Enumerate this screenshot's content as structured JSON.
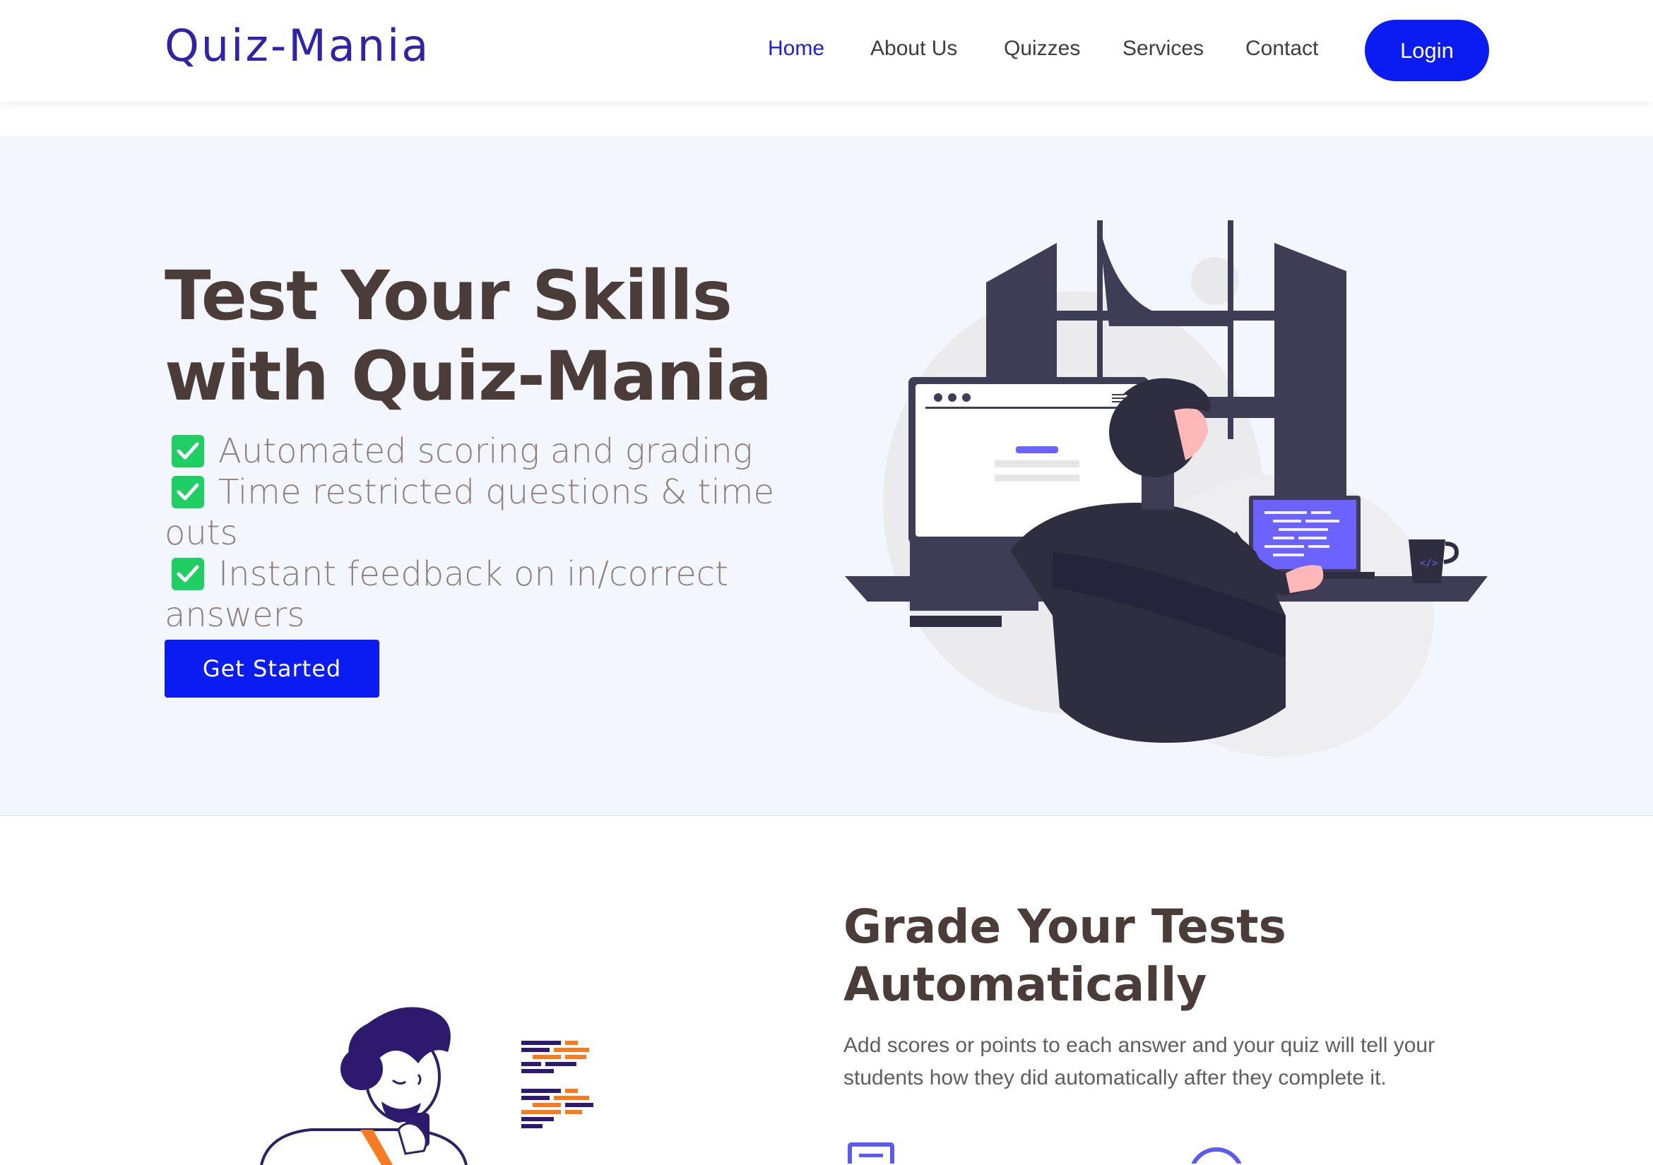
{
  "header": {
    "logo": "Quiz-Mania",
    "nav": [
      {
        "label": "Home",
        "active": true
      },
      {
        "label": "About Us",
        "active": false
      },
      {
        "label": "Quizzes",
        "active": false
      },
      {
        "label": "Services",
        "active": false
      },
      {
        "label": "Contact",
        "active": false
      }
    ],
    "login_label": "Login"
  },
  "hero": {
    "title": "Test Your Skills with Quiz-Mania",
    "features": [
      "Automated scoring and grading",
      "Time restricted questions & time outs",
      "Instant feedback on in/correct answers"
    ],
    "cta_label": "Get Started"
  },
  "section2": {
    "title": "Grade Your Tests Automatically",
    "description": "Add scores or points to each answer and your quiz will tell your students how they did automatically after they complete it."
  },
  "colors": {
    "brand": "#2f23a8",
    "primary_button": "#0a1cf2",
    "active_nav": "#1a22d6",
    "heading": "#4a3d39",
    "check": "#1fcf63",
    "hero_bg": "#f3f6fd"
  },
  "icons": [
    "check-icon",
    "document-icon",
    "clock-icon"
  ]
}
